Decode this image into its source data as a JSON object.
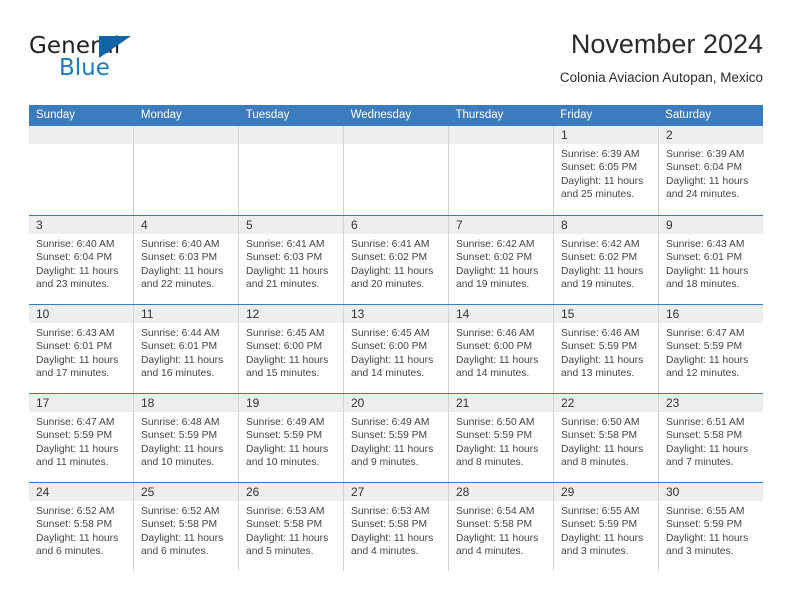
{
  "brand": {
    "word_general": "General",
    "word_blue": "Blue",
    "mark_icon": "triangle-logo-icon",
    "accent_color": "#1263a8"
  },
  "header": {
    "title": "November 2024",
    "subtitle": "Colonia Aviacion Autopan, Mexico"
  },
  "calendar": {
    "header_bg": "#3b7cbf",
    "daynum_bg": "#eeeeee",
    "weekdays": [
      "Sunday",
      "Monday",
      "Tuesday",
      "Wednesday",
      "Thursday",
      "Friday",
      "Saturday"
    ],
    "weeks": [
      [
        {
          "day": "",
          "lines": []
        },
        {
          "day": "",
          "lines": []
        },
        {
          "day": "",
          "lines": []
        },
        {
          "day": "",
          "lines": []
        },
        {
          "day": "",
          "lines": []
        },
        {
          "day": "1",
          "lines": [
            "Sunrise: 6:39 AM",
            "Sunset: 6:05 PM",
            "Daylight: 11 hours",
            "and 25 minutes."
          ]
        },
        {
          "day": "2",
          "lines": [
            "Sunrise: 6:39 AM",
            "Sunset: 6:04 PM",
            "Daylight: 11 hours",
            "and 24 minutes."
          ]
        }
      ],
      [
        {
          "day": "3",
          "lines": [
            "Sunrise: 6:40 AM",
            "Sunset: 6:04 PM",
            "Daylight: 11 hours",
            "and 23 minutes."
          ]
        },
        {
          "day": "4",
          "lines": [
            "Sunrise: 6:40 AM",
            "Sunset: 6:03 PM",
            "Daylight: 11 hours",
            "and 22 minutes."
          ]
        },
        {
          "day": "5",
          "lines": [
            "Sunrise: 6:41 AM",
            "Sunset: 6:03 PM",
            "Daylight: 11 hours",
            "and 21 minutes."
          ]
        },
        {
          "day": "6",
          "lines": [
            "Sunrise: 6:41 AM",
            "Sunset: 6:02 PM",
            "Daylight: 11 hours",
            "and 20 minutes."
          ]
        },
        {
          "day": "7",
          "lines": [
            "Sunrise: 6:42 AM",
            "Sunset: 6:02 PM",
            "Daylight: 11 hours",
            "and 19 minutes."
          ]
        },
        {
          "day": "8",
          "lines": [
            "Sunrise: 6:42 AM",
            "Sunset: 6:02 PM",
            "Daylight: 11 hours",
            "and 19 minutes."
          ]
        },
        {
          "day": "9",
          "lines": [
            "Sunrise: 6:43 AM",
            "Sunset: 6:01 PM",
            "Daylight: 11 hours",
            "and 18 minutes."
          ]
        }
      ],
      [
        {
          "day": "10",
          "lines": [
            "Sunrise: 6:43 AM",
            "Sunset: 6:01 PM",
            "Daylight: 11 hours",
            "and 17 minutes."
          ]
        },
        {
          "day": "11",
          "lines": [
            "Sunrise: 6:44 AM",
            "Sunset: 6:01 PM",
            "Daylight: 11 hours",
            "and 16 minutes."
          ]
        },
        {
          "day": "12",
          "lines": [
            "Sunrise: 6:45 AM",
            "Sunset: 6:00 PM",
            "Daylight: 11 hours",
            "and 15 minutes."
          ]
        },
        {
          "day": "13",
          "lines": [
            "Sunrise: 6:45 AM",
            "Sunset: 6:00 PM",
            "Daylight: 11 hours",
            "and 14 minutes."
          ]
        },
        {
          "day": "14",
          "lines": [
            "Sunrise: 6:46 AM",
            "Sunset: 6:00 PM",
            "Daylight: 11 hours",
            "and 14 minutes."
          ]
        },
        {
          "day": "15",
          "lines": [
            "Sunrise: 6:46 AM",
            "Sunset: 5:59 PM",
            "Daylight: 11 hours",
            "and 13 minutes."
          ]
        },
        {
          "day": "16",
          "lines": [
            "Sunrise: 6:47 AM",
            "Sunset: 5:59 PM",
            "Daylight: 11 hours",
            "and 12 minutes."
          ]
        }
      ],
      [
        {
          "day": "17",
          "lines": [
            "Sunrise: 6:47 AM",
            "Sunset: 5:59 PM",
            "Daylight: 11 hours",
            "and 11 minutes."
          ]
        },
        {
          "day": "18",
          "lines": [
            "Sunrise: 6:48 AM",
            "Sunset: 5:59 PM",
            "Daylight: 11 hours",
            "and 10 minutes."
          ]
        },
        {
          "day": "19",
          "lines": [
            "Sunrise: 6:49 AM",
            "Sunset: 5:59 PM",
            "Daylight: 11 hours",
            "and 10 minutes."
          ]
        },
        {
          "day": "20",
          "lines": [
            "Sunrise: 6:49 AM",
            "Sunset: 5:59 PM",
            "Daylight: 11 hours",
            "and 9 minutes."
          ]
        },
        {
          "day": "21",
          "lines": [
            "Sunrise: 6:50 AM",
            "Sunset: 5:59 PM",
            "Daylight: 11 hours",
            "and 8 minutes."
          ]
        },
        {
          "day": "22",
          "lines": [
            "Sunrise: 6:50 AM",
            "Sunset: 5:58 PM",
            "Daylight: 11 hours",
            "and 8 minutes."
          ]
        },
        {
          "day": "23",
          "lines": [
            "Sunrise: 6:51 AM",
            "Sunset: 5:58 PM",
            "Daylight: 11 hours",
            "and 7 minutes."
          ]
        }
      ],
      [
        {
          "day": "24",
          "lines": [
            "Sunrise: 6:52 AM",
            "Sunset: 5:58 PM",
            "Daylight: 11 hours",
            "and 6 minutes."
          ]
        },
        {
          "day": "25",
          "lines": [
            "Sunrise: 6:52 AM",
            "Sunset: 5:58 PM",
            "Daylight: 11 hours",
            "and 6 minutes."
          ]
        },
        {
          "day": "26",
          "lines": [
            "Sunrise: 6:53 AM",
            "Sunset: 5:58 PM",
            "Daylight: 11 hours",
            "and 5 minutes."
          ]
        },
        {
          "day": "27",
          "lines": [
            "Sunrise: 6:53 AM",
            "Sunset: 5:58 PM",
            "Daylight: 11 hours",
            "and 4 minutes."
          ]
        },
        {
          "day": "28",
          "lines": [
            "Sunrise: 6:54 AM",
            "Sunset: 5:58 PM",
            "Daylight: 11 hours",
            "and 4 minutes."
          ]
        },
        {
          "day": "29",
          "lines": [
            "Sunrise: 6:55 AM",
            "Sunset: 5:59 PM",
            "Daylight: 11 hours",
            "and 3 minutes."
          ]
        },
        {
          "day": "30",
          "lines": [
            "Sunrise: 6:55 AM",
            "Sunset: 5:59 PM",
            "Daylight: 11 hours",
            "and 3 minutes."
          ]
        }
      ]
    ]
  }
}
